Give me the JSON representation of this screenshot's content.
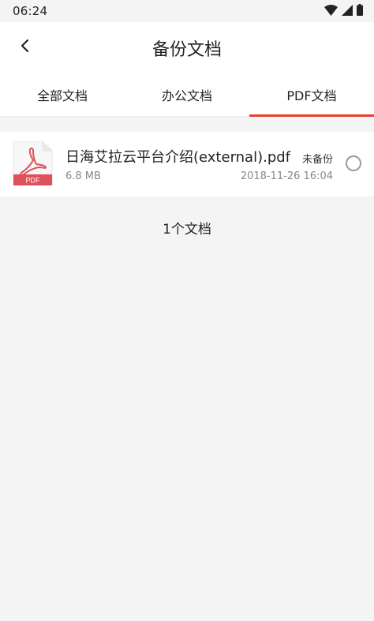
{
  "status_bar": {
    "time": "06:24",
    "icons": [
      "wifi-icon",
      "cellular-signal-icon",
      "battery-icon"
    ]
  },
  "header": {
    "back_icon": "chevron-left-icon",
    "title": "备份文档"
  },
  "tabs": [
    {
      "label": "全部文档",
      "active": false
    },
    {
      "label": "办公文档",
      "active": false
    },
    {
      "label": "PDF文档",
      "active": true
    }
  ],
  "files": [
    {
      "icon": "pdf-file-icon",
      "icon_label": "PDF",
      "name": "日海艾拉云平台介绍(external).pdf",
      "size": "6.8 MB",
      "backup_status": "未备份",
      "date": "2018-11-26 16:04",
      "selected": false
    }
  ],
  "footer": {
    "count_text": "1个文档"
  },
  "colors": {
    "accent": "#e5402b",
    "pdf_red": "#e0505c",
    "background": "#f4f4f4"
  }
}
